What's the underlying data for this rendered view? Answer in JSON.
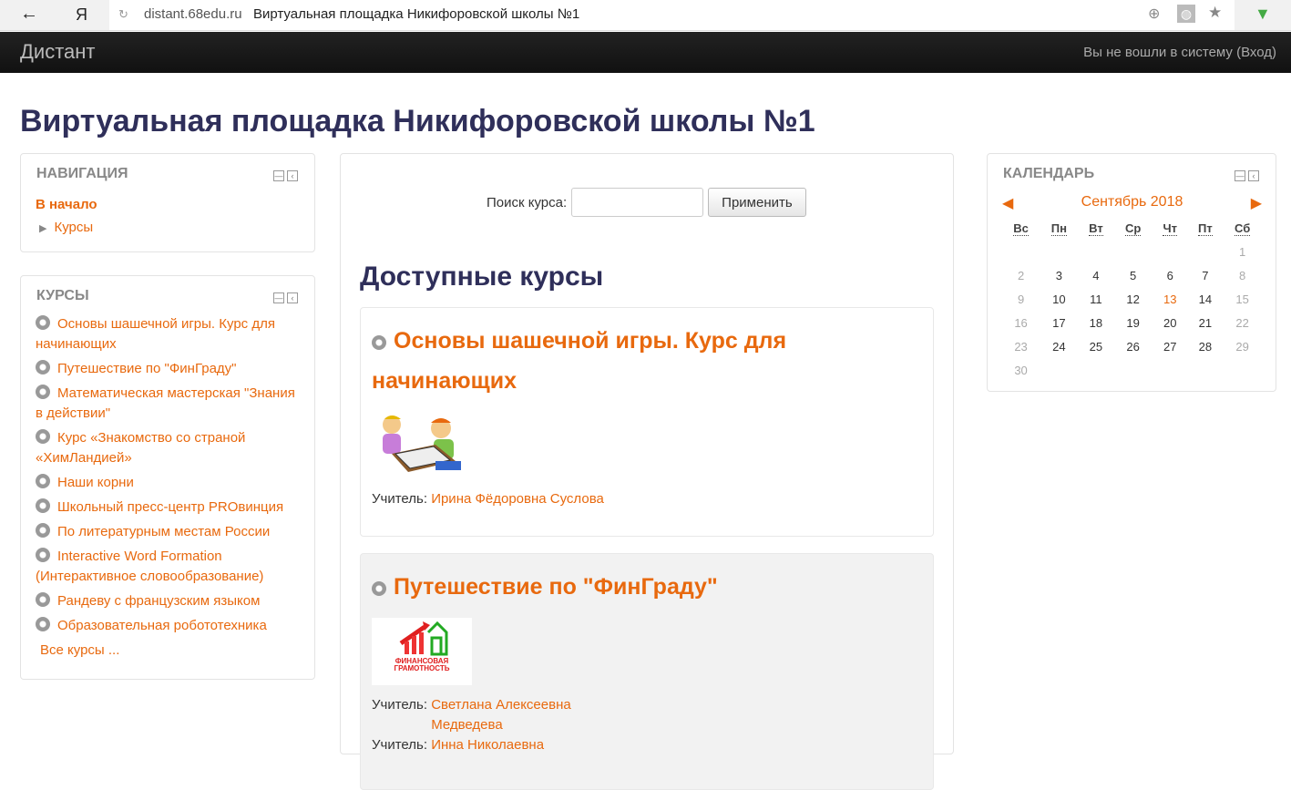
{
  "browser": {
    "back": "←",
    "logo": "Я",
    "reload": "↻",
    "url": "distant.68edu.ru",
    "title": "Виртуальная площадка Никифоровской школы №1"
  },
  "navbar": {
    "brand": "Дистант",
    "login": "Вы не вошли в систему (Вход)"
  },
  "page_title": "Виртуальная площадка Никифоровской школы №1",
  "navigation": {
    "title": "НАВИГАЦИЯ",
    "home": "В начало",
    "courses": "Курсы"
  },
  "courses_block": {
    "title": "КУРСЫ",
    "items": [
      "Основы шашечной игры. Курс для начинающих",
      "Путешествие по \"ФинГраду\"",
      "Математическая мастерская \"Знания в действии\"",
      "Курс «Знакомство со страной «ХимЛандией»",
      "Наши корни",
      "Школьный пресс-центр PROвинция",
      "По литературным местам России",
      "Interactive Word Formation (Интерактивное словообразование)",
      "Рандеву с французским языком",
      "Образовательная робототехника"
    ],
    "all": "Все курсы ..."
  },
  "main": {
    "search_label": "Поиск курса:",
    "search_value": "",
    "apply": "Применить",
    "available": "Доступные курсы",
    "courses": [
      {
        "title": "Основы шашечной игры. Курс для начинающих",
        "teacher_label": "Учитель:",
        "teachers": [
          "Ирина Фёдоровна Суслова"
        ]
      },
      {
        "title": "Путешествие по \"ФинГраду\"",
        "teacher_label": "Учитель:",
        "teachers": [
          "Светлана Алексеевна Медведева",
          "Инна Николаевна"
        ],
        "image_text": "ФИНАНСОВАЯ ГРАМОТНОСТЬ"
      }
    ]
  },
  "calendar": {
    "title": "КАЛЕНДАРЬ",
    "month": "Сентябрь 2018",
    "days": [
      "Вс",
      "Пн",
      "Вт",
      "Ср",
      "Чт",
      "Пт",
      "Сб"
    ],
    "today": 13,
    "weeks": [
      [
        "",
        "",
        "",
        "",
        "",
        "",
        "1"
      ],
      [
        "2",
        "3",
        "4",
        "5",
        "6",
        "7",
        "8"
      ],
      [
        "9",
        "10",
        "11",
        "12",
        "13",
        "14",
        "15"
      ],
      [
        "16",
        "17",
        "18",
        "19",
        "20",
        "21",
        "22"
      ],
      [
        "23",
        "24",
        "25",
        "26",
        "27",
        "28",
        "29"
      ],
      [
        "30",
        "",
        "",
        "",
        "",
        "",
        ""
      ]
    ]
  },
  "colors": {
    "accent": "#e8690e",
    "title": "#2f2f5a",
    "navbar": "#1a1a1a"
  }
}
